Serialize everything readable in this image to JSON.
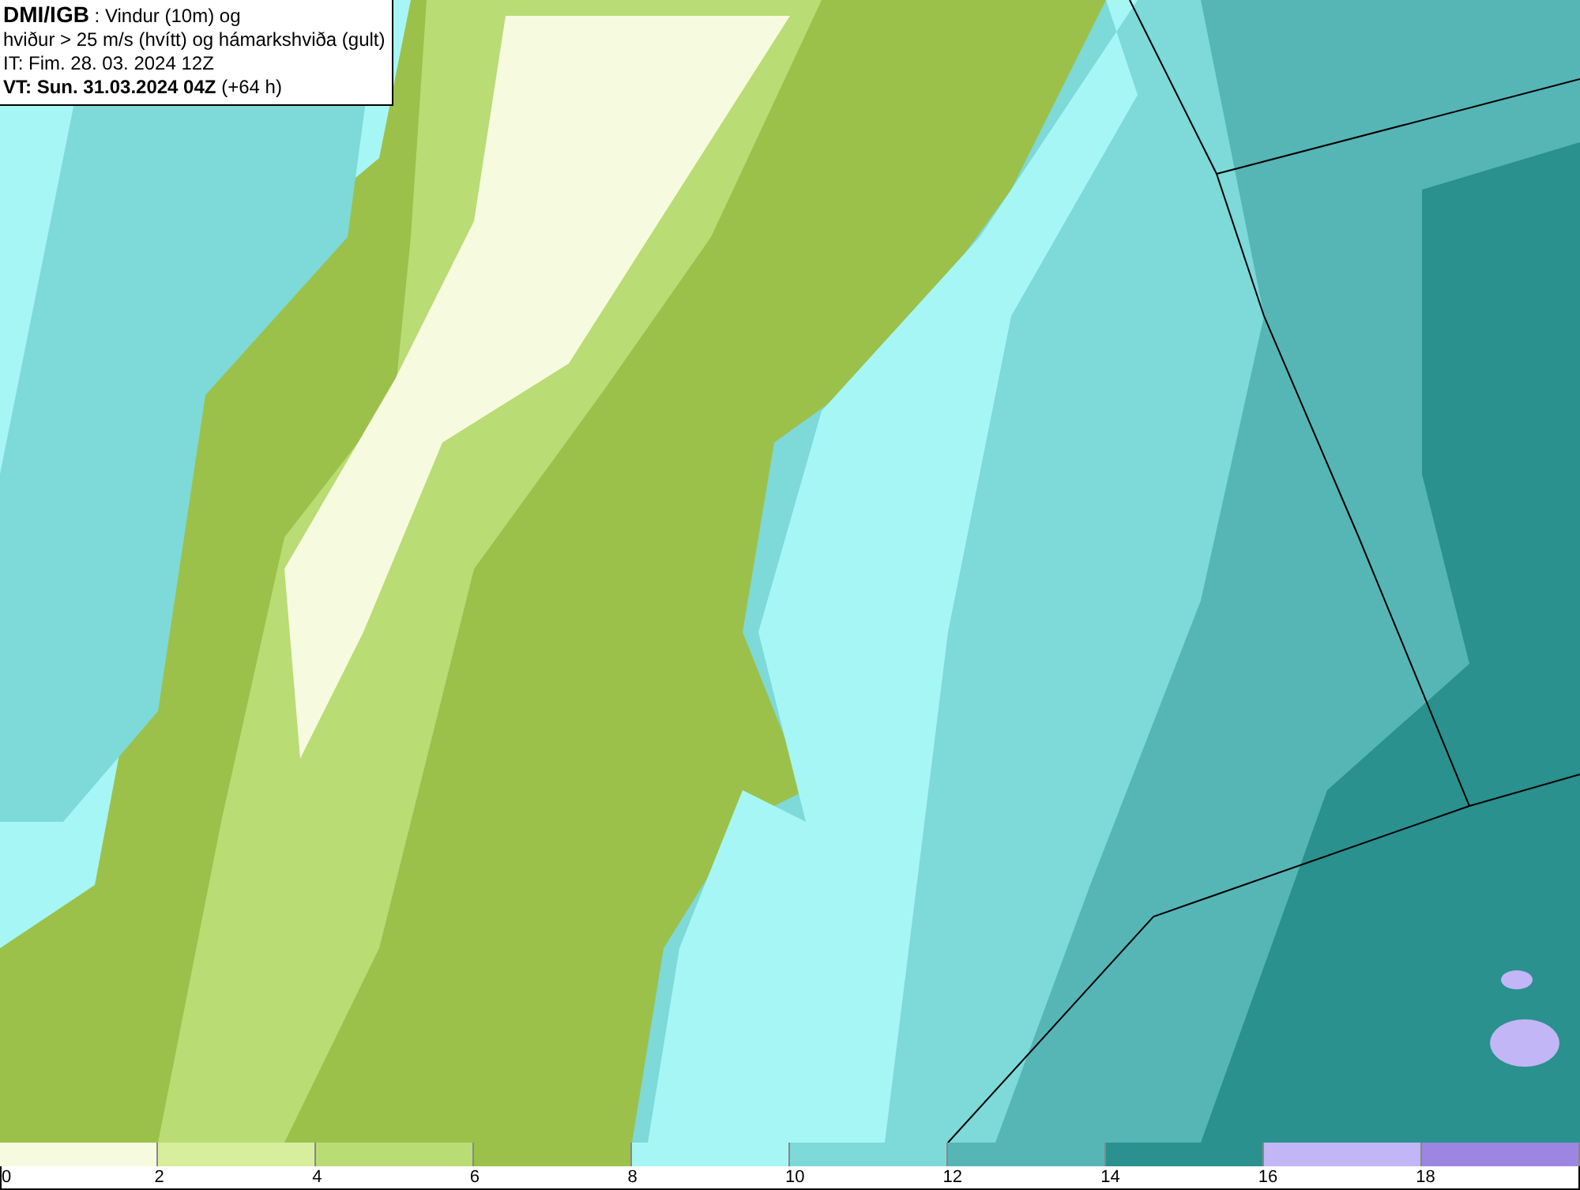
{
  "title_box": {
    "lines": [
      "**DMI/IGB** : Vindur (10m) og",
      "hviður > 25 m/s (hvítt) og hámarkshviða (gult)",
      "IT: Fim. 28. 03. 2024 12Z",
      "**VT: Sun. 31.03.2024 04Z** (+64 h)"
    ]
  },
  "legend": {
    "bins": [
      {
        "label": "0",
        "color": "#f6fbe0"
      },
      {
        "label": "2",
        "color": "#d7ee9c"
      },
      {
        "label": "4",
        "color": "#b9dc74"
      },
      {
        "label": "6",
        "color": "#9cc14a"
      },
      {
        "label": "8",
        "color": "#a6f6f6"
      },
      {
        "label": "10",
        "color": "#7ed9d9"
      },
      {
        "label": "12",
        "color": "#56b6b6"
      },
      {
        "label": "14",
        "color": "#2a918e"
      },
      {
        "label": "16",
        "color": "#c2b6f6"
      },
      {
        "label": "18",
        "color": "#9c86e2"
      }
    ]
  }
}
